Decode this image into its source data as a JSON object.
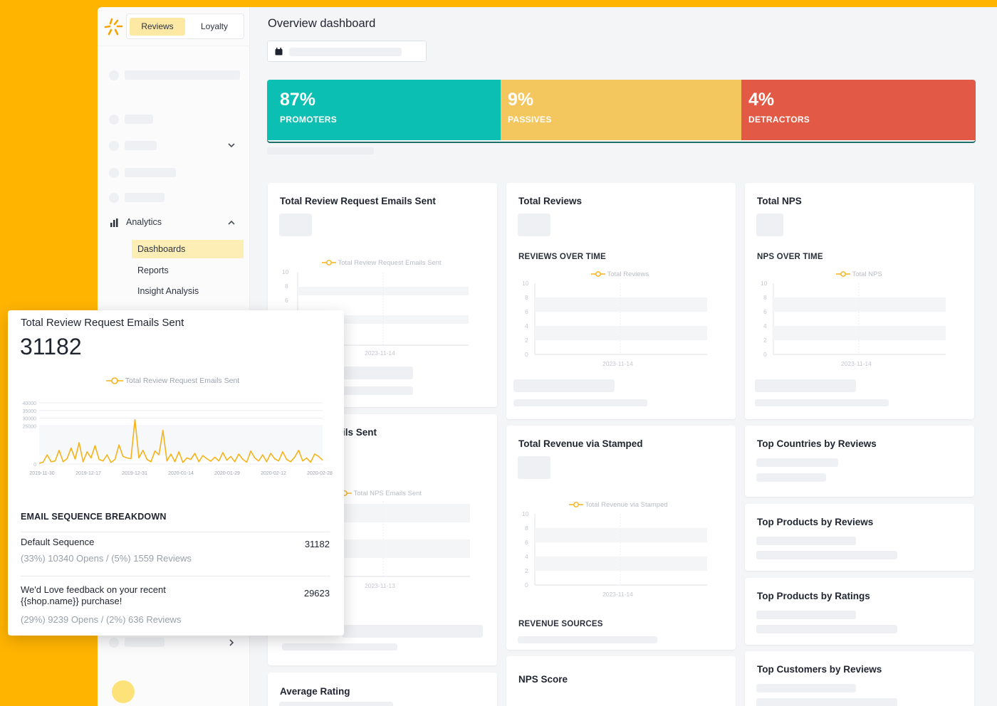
{
  "sidebar": {
    "tabs": [
      "Reviews",
      "Loyalty"
    ],
    "analytics_label": "Analytics",
    "items": [
      "Dashboards",
      "Reports",
      "Insight Analysis"
    ]
  },
  "header": {
    "title": "Overview dashboard"
  },
  "nps": [
    {
      "percent": "87%",
      "label": "PROMOTERS",
      "color": "#0bbfb2"
    },
    {
      "percent": "9%",
      "label": "PASSIVES",
      "color": "#f4c65e"
    },
    {
      "percent": "4%",
      "label": "DETRACTORS",
      "color": "#e25a45"
    }
  ],
  "cards": {
    "emails": {
      "title": "Total Review Request Emails Sent",
      "legend": "Total Review Request Emails Sent",
      "date": "2023-11-14"
    },
    "reviews": {
      "title": "Total Reviews",
      "sub": "REVIEWS OVER TIME",
      "legend": "Total Reviews",
      "date": "2023-11-14"
    },
    "nps": {
      "title": "Total NPS",
      "sub": "NPS OVER TIME",
      "legend": "Total NPS",
      "date": "2023-11-14"
    },
    "nps_emails": {
      "title_tail": "ils Sent",
      "legend": "Total NPS Emails Sent",
      "date": "2023-11-13"
    },
    "revenue": {
      "title": "Total Revenue via Stamped",
      "legend": "Total Revenue via Stamped",
      "date": "2023-11-14",
      "sub": "REVENUE SOURCES"
    },
    "countries": {
      "title": "Top Countries by Reviews"
    },
    "products_reviews": {
      "title": "Top Products by Reviews"
    },
    "products_ratings": {
      "title": "Top Products by Ratings"
    },
    "customers": {
      "title": "Top Customers by Reviews"
    },
    "nps_score": {
      "title": "NPS Score"
    },
    "avg_rating": {
      "title": "Average Rating"
    }
  },
  "small_axis": [
    "10",
    "8",
    "6",
    "4",
    "2",
    "0"
  ],
  "floating": {
    "title": "Total Review Request Emails Sent",
    "total": "31182",
    "legend": "Total Review Request Emails Sent",
    "section": "EMAIL SEQUENCE BREAKDOWN",
    "rows": [
      {
        "name": "Default Sequence",
        "meta": "(33%) 10340 Opens / (5%) 1559 Reviews",
        "value": "31182"
      },
      {
        "name": "We'd Love feedback on your recent {{shop.name}} purchase!",
        "meta": "(29%) 9239 Opens / (2%) 636 Reviews",
        "value": "29623"
      }
    ]
  },
  "chart_data": {
    "type": "line",
    "title": "",
    "series": [
      {
        "name": "Total Review Request Emails Sent",
        "color": "#f5b21a",
        "values": [
          500,
          1200,
          6000,
          1500,
          2000,
          9000,
          1500,
          3500,
          10500,
          3200,
          14000,
          1500,
          8000,
          4000,
          12000,
          3000,
          2000,
          6000,
          1000,
          3000,
          12500,
          5000,
          4000,
          3500,
          29000,
          4000,
          9000,
          3000,
          1500,
          8500,
          6000,
          22000,
          2000,
          6500,
          1500,
          8000,
          1000,
          4000,
          3000,
          7000,
          1500,
          5500,
          3500,
          1800,
          4500,
          2000,
          7500,
          2500,
          5000,
          1500,
          6500,
          3000,
          1200,
          8500,
          4000,
          2000,
          6000,
          1500,
          7000,
          3500,
          2000,
          8000,
          3000,
          1500,
          4500,
          9000,
          2000,
          4000,
          1200,
          6500,
          5000,
          2500
        ]
      }
    ],
    "x_ticks": [
      "2019-11-30",
      "2019-12-17",
      "2019-12-31",
      "2020-01-14",
      "2020-01-29",
      "2020-02-12",
      "2020-02-28"
    ],
    "y_ticks": [
      "40000",
      "35000",
      "30000",
      "25000",
      "0"
    ],
    "ylim": [
      0,
      40000
    ]
  }
}
